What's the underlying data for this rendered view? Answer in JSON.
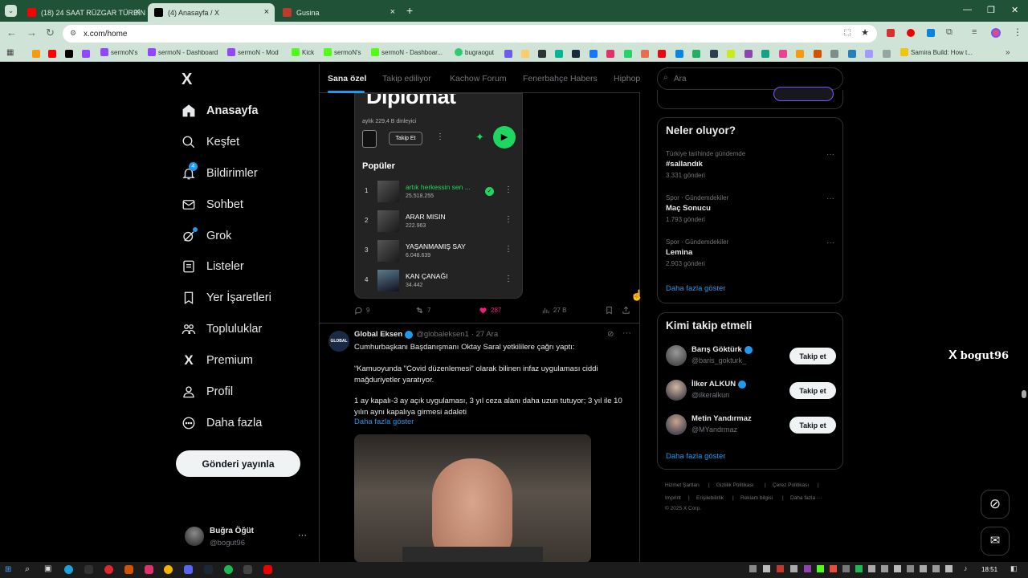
{
  "browser": {
    "tabs": [
      {
        "label": "(18) 24 SAAT RÜZGAR TÜRBİNİ",
        "fav": "#ff0000"
      },
      {
        "label": "(4) Anasayfa / X",
        "fav": "#000000"
      },
      {
        "label": "Gusina",
        "fav": "#c0392b"
      }
    ],
    "url": "x.com/home",
    "bookmarks": [
      {
        "label": "sermoN's",
        "color": "#9146ff"
      },
      {
        "label": "sermoN - Dashboard",
        "color": "#9146ff"
      },
      {
        "label": "sermoN - Mod",
        "color": "#9146ff"
      },
      {
        "label": "Kick",
        "color": "#53fc18"
      },
      {
        "label": "sermoN's",
        "color": "#53fc18"
      },
      {
        "label": "sermoN - Dashboar...",
        "color": "#53fc18"
      },
      {
        "label": "bugraogut",
        "color": "#2ecc71"
      },
      {
        "label": "Samira Build: How t...",
        "color": "#f1c40f"
      }
    ]
  },
  "sidebar": {
    "logo": "X",
    "items": [
      {
        "label": "Anasayfa",
        "icon": "home-icon"
      },
      {
        "label": "Keşfet",
        "icon": "search-icon"
      },
      {
        "label": "Bildirimler",
        "icon": "bell-icon",
        "badge": "4"
      },
      {
        "label": "Sohbet",
        "icon": "mail-icon"
      },
      {
        "label": "Grok",
        "icon": "grok-icon"
      },
      {
        "label": "Listeler",
        "icon": "list-icon"
      },
      {
        "label": "Yer İşaretleri",
        "icon": "bookmark-icon"
      },
      {
        "label": "Topluluklar",
        "icon": "communities-icon"
      },
      {
        "label": "Premium",
        "icon": "x-premium-icon"
      },
      {
        "label": "Profil",
        "icon": "profile-icon"
      },
      {
        "label": "Daha fazla",
        "icon": "more-circle-icon"
      }
    ],
    "post_button": "Gönderi yayınla",
    "account": {
      "name": "Buğra Öğüt",
      "handle": "@bogut96",
      "more": "···"
    }
  },
  "feed": {
    "tabs": [
      "Sana özel",
      "Takip ediliyor",
      "Kachow Forum",
      "Fenerbahçe Habers",
      "Hiphop"
    ],
    "spotify": {
      "artist": "Diplomat",
      "listeners": "aylık 229,4 B dinleyici",
      "follow": "Takip Et",
      "popular": "Popüler",
      "tracks": [
        {
          "n": "1",
          "title": "artık herkessin sen ...",
          "plays": "25.518.255",
          "highlight": true
        },
        {
          "n": "2",
          "title": "ARAR MISIN",
          "plays": "222.963"
        },
        {
          "n": "3",
          "title": "YAŞANMAMIŞ SAY",
          "plays": "6.048.639"
        },
        {
          "n": "4",
          "title": "KAN ÇANAĞI",
          "plays": "34.442"
        }
      ]
    },
    "post1_stats": {
      "replies": "9",
      "reposts": "7",
      "likes": "287",
      "views": "27 B"
    },
    "post2": {
      "avatar_text": "GLOBAL",
      "name": "Global Eksen",
      "handle": "@globaleksen1",
      "date": "· 27 Ara",
      "line1": "Cumhurbaşkanı Başdanışmanı Oktay Saral yetkililere çağrı yaptı:",
      "line2": "“Kamuoyunda \"Covid düzenlemesi\" olarak bilinen infaz uygulaması ciddi mağduriyetler yaratıyor.",
      "line3": "1 ay kapalı-3 ay açık uygulaması, 3 yıl ceza alanı daha uzun tutuyor; 3 yıl ile 10 yılın aynı kapalıya girmesi adaleti",
      "more": "Daha fazla göster"
    }
  },
  "right": {
    "search_placeholder": "Ara",
    "trends_title": "Neler oluyor?",
    "trends": [
      {
        "cat": "Türkiye tarihinde gündemde",
        "title": "#sallandık",
        "count": "3.331 gönderi"
      },
      {
        "cat": "Spor · Gündemdekiler",
        "title": "Maç Sonucu",
        "count": "1.793 gönderi"
      },
      {
        "cat": "Spor · Gündemdekiler",
        "title": "Lemina",
        "count": "2.903 gönderi"
      }
    ],
    "show_more": "Daha fazla göster",
    "who_title": "Kimi takip etmeli",
    "who": [
      {
        "name": "Barış Göktürk",
        "handle": "@baris_gokturk_",
        "btn": "Takip et"
      },
      {
        "name": "İlker ALKUN",
        "handle": "@ilkeralkun",
        "btn": "Takip et"
      },
      {
        "name": "Metin Yandırmaz",
        "handle": "@MYandrmaz",
        "btn": "Takip et"
      }
    ],
    "footer": [
      "Hizmet Şartları",
      "|",
      "Gizlilik Politikası",
      "|",
      "Çerez Politikası",
      "|",
      "Imprint",
      "|",
      "Erişilebilirlik",
      "|",
      "Reklam bilgisi",
      "|",
      "Daha fazla ···",
      "© 2025 X Corp."
    ]
  },
  "watermark": "bogut96",
  "clock": "18:51"
}
